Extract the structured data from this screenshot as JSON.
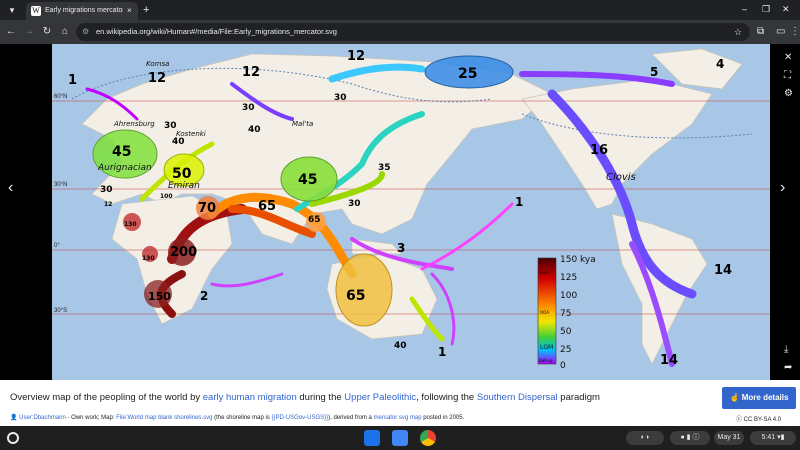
{
  "browser": {
    "tab": {
      "title": "Early migrations mercator - Hu",
      "favicon": "W",
      "close": "×"
    },
    "newtab": "+",
    "url": "en.wikipedia.org/wiki/Human#/media/File:Early_migrations_mercator.svg",
    "window_controls": {
      "minimize": "–",
      "maximize": "❐",
      "close": "✕"
    }
  },
  "map": {
    "lat_labels": [
      "60°N",
      "30°N",
      "0°",
      "30°S"
    ],
    "migration_numbers": [
      "1",
      "12",
      "12",
      "12",
      "25",
      "5",
      "4",
      "30",
      "30",
      "40",
      "40",
      "30",
      "45",
      "50",
      "30",
      "45",
      "35",
      "16",
      "12",
      "100",
      "130",
      "130",
      "70",
      "65",
      "65",
      "30",
      "200",
      "150",
      "2",
      "3",
      "1",
      "65",
      "40",
      "1",
      "14",
      "14"
    ],
    "place_labels": [
      "Komsa",
      "Ahrensburg",
      "Kostenki",
      "Mal'ta",
      "Aurignacian",
      "Emiran",
      "Clovis"
    ],
    "legend": {
      "ticks": [
        "150 kya",
        "125",
        "100",
        "75",
        "50",
        "25",
        "0"
      ],
      "inner_labels": [
        "Eem",
        "OOA",
        "LGM",
        "Bølling"
      ]
    }
  },
  "caption": {
    "text_1": "Overview map of the peopling of the world by ",
    "link_1": "early human migration",
    "text_2": " during the ",
    "link_2": "Upper Paleolithic",
    "text_3": ", following the ",
    "link_3": "Southern Dispersal",
    "text_4": " paradigm",
    "more_details": "More details",
    "credit_user": "User:Dbachmann",
    "credit_1": " - Own work; Map: ",
    "credit_link": "File:World map blank shorelines.svg",
    "credit_2": " (the shoreline map is ",
    "credit_code": "{{PD-USGov-USGS}}",
    "credit_3": "), derived from a ",
    "credit_link2": "mercator svg map",
    "credit_4": " posted in 2005.",
    "license": "CC BY-SA 4.0"
  },
  "shelf": {
    "date": "May 31",
    "time": "5:41"
  },
  "colors": {
    "ocean": "#a8c7e6",
    "land": "#f3efe6",
    "link": "#3366cc",
    "button": "#3366cc"
  }
}
